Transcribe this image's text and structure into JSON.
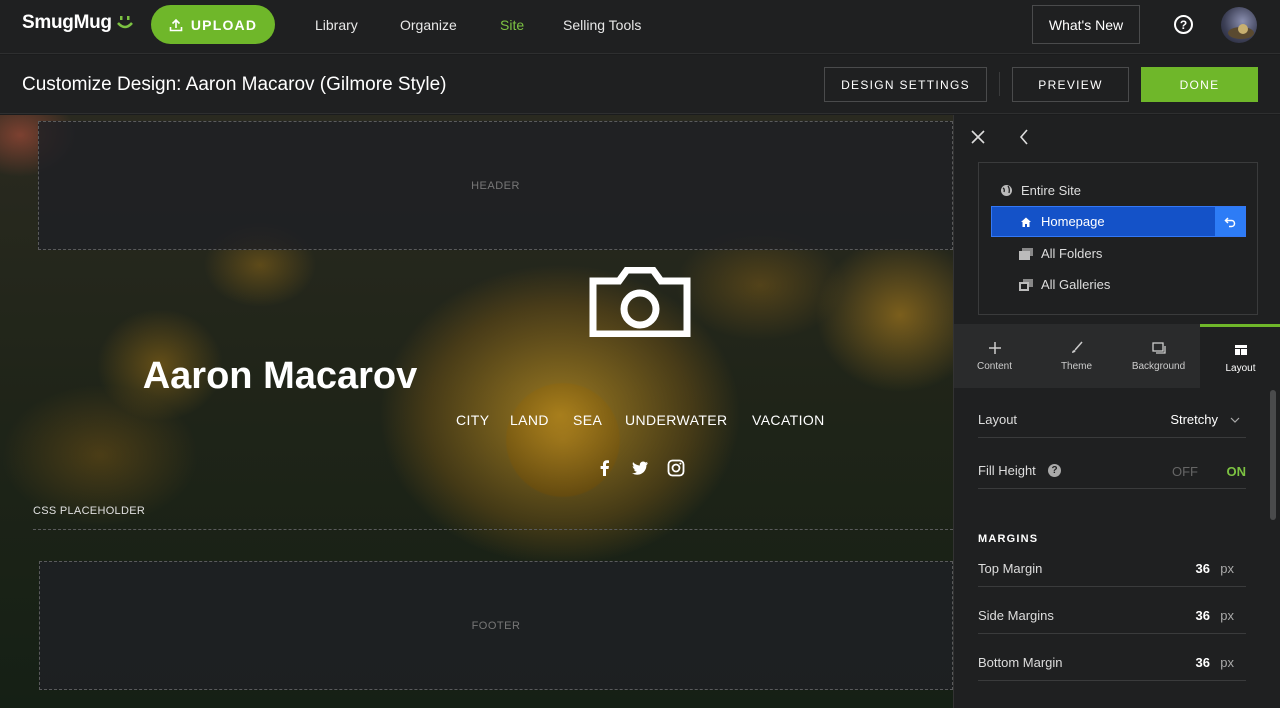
{
  "topbar": {
    "logo": "SmugMug",
    "upload_label": "UPLOAD",
    "nav": [
      "Library",
      "Organize",
      "Site",
      "Selling Tools"
    ],
    "active_nav": "Site",
    "whats_new_label": "What's New",
    "help_glyph": "?"
  },
  "subbar": {
    "title": "Customize Design: Aaron Macarov (Gilmore Style)",
    "design_settings_label": "DESIGN SETTINGS",
    "preview_label": "PREVIEW",
    "done_label": "DONE"
  },
  "canvas": {
    "header_label": "HEADER",
    "css_placeholder_label": "CSS PLACEHOLDER",
    "footer_label": "FOOTER",
    "site_title": "Aaron Macarov",
    "site_nav": [
      "CITY",
      "LAND",
      "SEA",
      "UNDERWATER",
      "VACATION"
    ],
    "social_icons": [
      "facebook-icon",
      "twitter-icon",
      "instagram-icon"
    ]
  },
  "panel": {
    "tree": {
      "entire_site": "Entire Site",
      "homepage": "Homepage",
      "all_folders": "All Folders",
      "all_galleries": "All Galleries"
    },
    "tabs": [
      "Content",
      "Theme",
      "Background",
      "Layout"
    ],
    "active_tab": "Layout",
    "layout_label": "Layout",
    "layout_value": "Stretchy",
    "fill_height_label": "Fill Height",
    "fill_height_off": "OFF",
    "fill_height_on": "ON",
    "margins_heading": "MARGINS",
    "top_margin_label": "Top Margin",
    "top_margin_value": "36",
    "side_margins_label": "Side Margins",
    "side_margins_value": "36",
    "bottom_margin_label": "Bottom Margin",
    "bottom_margin_value": "36",
    "unit": "px"
  },
  "colors": {
    "accent_green": "#6fb72a",
    "selection_blue": "#1452c8",
    "background_dark": "#1f2021"
  }
}
